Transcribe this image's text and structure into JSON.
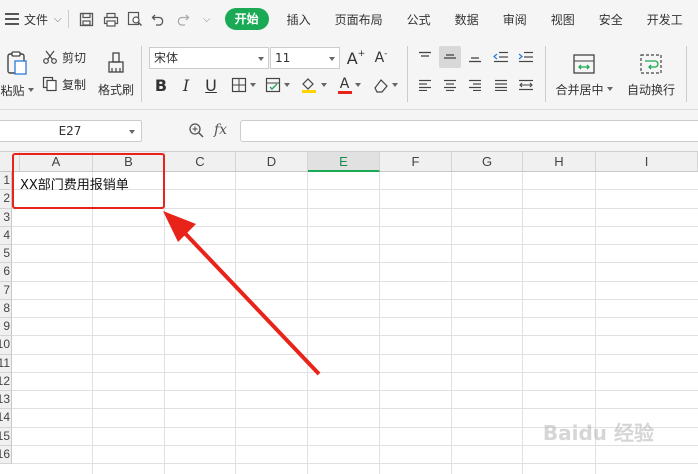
{
  "menubar": {
    "file_label": "文件",
    "tabs": [
      {
        "label": "开始",
        "active": true
      },
      {
        "label": "插入"
      },
      {
        "label": "页面布局"
      },
      {
        "label": "公式"
      },
      {
        "label": "数据"
      },
      {
        "label": "审阅"
      },
      {
        "label": "视图"
      },
      {
        "label": "安全"
      },
      {
        "label": "开发工"
      }
    ],
    "quick_access_icons": [
      "save-icon",
      "print-icon",
      "print-preview-icon",
      "undo-icon",
      "redo-icon",
      "more-icon"
    ]
  },
  "ribbon": {
    "paste_label": "粘贴",
    "cut_label": "剪切",
    "copy_label": "复制",
    "format_painter_label": "格式刷",
    "font_name": "宋体",
    "font_size": "11",
    "bold": "B",
    "italic": "I",
    "underline": "U",
    "merge_center_label": "合并居中",
    "wrap_text_label": "自动换行",
    "icons": [
      "increase-font-icon",
      "decrease-font-icon",
      "border-icon",
      "fill-color-icon",
      "font-color-icon",
      "clear-icon",
      "align-top-icon",
      "align-middle-icon",
      "align-bottom-icon",
      "align-left-icon",
      "align-center-icon",
      "align-right-icon",
      "indent-icon",
      "outdent-icon",
      "distributed-icon"
    ],
    "accent_color": "#1aaa55"
  },
  "formula_bar": {
    "name_box": "E27",
    "fx_label": "fx",
    "formula_value": ""
  },
  "sheet": {
    "columns": [
      "A",
      "B",
      "C",
      "D",
      "E",
      "F",
      "G",
      "H",
      "I"
    ],
    "active_column": "E",
    "rows": [
      "1",
      "2",
      "3",
      "4",
      "5",
      "6",
      "7",
      "8",
      "9",
      "10",
      "11",
      "12",
      "13",
      "14",
      "15",
      "16"
    ],
    "cell_a1": "XX部门费用报销单"
  },
  "annotation": {
    "box_color": "#e8231a",
    "arrow_color": "#e8231a"
  },
  "watermark": "Baidu 经验"
}
